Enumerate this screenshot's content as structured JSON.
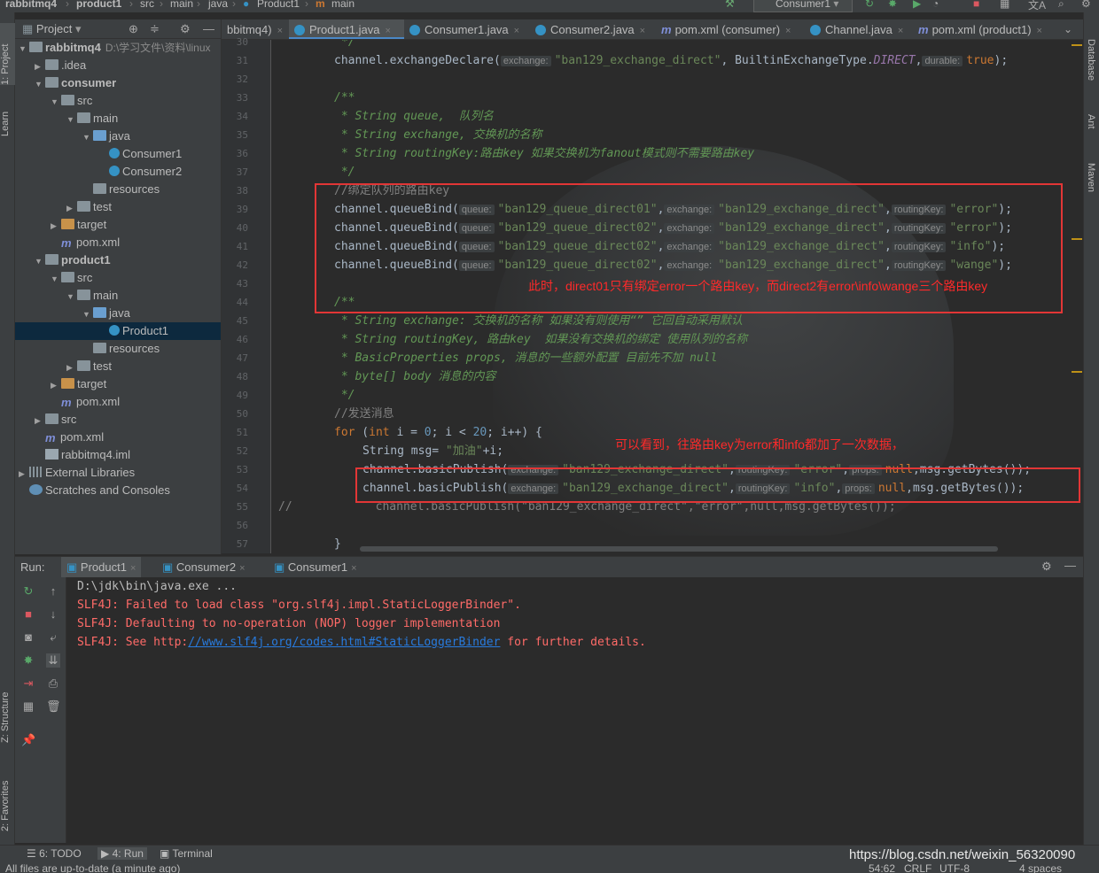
{
  "navbar": {
    "crumbs": [
      "rabbitmq4",
      "product1",
      "src",
      "main",
      "java",
      "Product1",
      "main"
    ],
    "run_config": "Consumer1"
  },
  "left_strip": {
    "project": "1: Project",
    "learn": "Learn",
    "structure": "Z: Structure",
    "favorites": "2: Favorites"
  },
  "right_strip": {
    "database": "Database",
    "ant": "Ant",
    "maven": "Maven"
  },
  "project_panel": {
    "title": "Project",
    "tree": [
      {
        "label": "rabbitmq4",
        "path": "D:\\学习文件\\资料\\linux",
        "bold": true,
        "indent": 0,
        "arrow": "▼",
        "icon": "folder"
      },
      {
        "label": ".idea",
        "indent": 1,
        "arrow": "▶",
        "icon": "folder"
      },
      {
        "label": "consumer",
        "bold": true,
        "indent": 1,
        "arrow": "▼",
        "icon": "folder"
      },
      {
        "label": "src",
        "indent": 2,
        "arrow": "▼",
        "icon": "folder"
      },
      {
        "label": "main",
        "indent": 3,
        "arrow": "▼",
        "icon": "folder"
      },
      {
        "label": "java",
        "indent": 4,
        "arrow": "▼",
        "icon": "folder-b"
      },
      {
        "label": "Consumer1",
        "indent": 5,
        "arrow": "",
        "icon": "class"
      },
      {
        "label": "Consumer2",
        "indent": 5,
        "arrow": "",
        "icon": "class"
      },
      {
        "label": "resources",
        "indent": 4,
        "arrow": "",
        "icon": "folder"
      },
      {
        "label": "test",
        "indent": 3,
        "arrow": "▶",
        "icon": "folder"
      },
      {
        "label": "target",
        "indent": 2,
        "arrow": "▶",
        "icon": "folder-o"
      },
      {
        "label": "pom.xml",
        "indent": 2,
        "arrow": "",
        "icon": "maven"
      },
      {
        "label": "product1",
        "bold": true,
        "indent": 1,
        "arrow": "▼",
        "icon": "folder"
      },
      {
        "label": "src",
        "indent": 2,
        "arrow": "▼",
        "icon": "folder"
      },
      {
        "label": "main",
        "indent": 3,
        "arrow": "▼",
        "icon": "folder"
      },
      {
        "label": "java",
        "indent": 4,
        "arrow": "▼",
        "icon": "folder-b"
      },
      {
        "label": "Product1",
        "indent": 5,
        "arrow": "",
        "icon": "class",
        "selected": true
      },
      {
        "label": "resources",
        "indent": 4,
        "arrow": "",
        "icon": "folder"
      },
      {
        "label": "test",
        "indent": 3,
        "arrow": "▶",
        "icon": "folder"
      },
      {
        "label": "target",
        "indent": 2,
        "arrow": "▶",
        "icon": "folder-o"
      },
      {
        "label": "pom.xml",
        "indent": 2,
        "arrow": "",
        "icon": "maven"
      },
      {
        "label": "src",
        "indent": 1,
        "arrow": "▶",
        "icon": "folder"
      },
      {
        "label": "pom.xml",
        "indent": 1,
        "arrow": "",
        "icon": "maven"
      },
      {
        "label": "rabbitmq4.iml",
        "indent": 1,
        "arrow": "",
        "icon": "file"
      },
      {
        "label": "External Libraries",
        "indent": 0,
        "arrow": "▶",
        "icon": "lib"
      },
      {
        "label": "Scratches and Consoles",
        "indent": 0,
        "arrow": "",
        "icon": "scratch"
      }
    ]
  },
  "tabs": [
    {
      "label": "bbitmq4)",
      "icon": "none",
      "active": false
    },
    {
      "label": "Product1.java",
      "icon": "class",
      "active": true
    },
    {
      "label": "Consumer1.java",
      "icon": "class",
      "active": false
    },
    {
      "label": "Consumer2.java",
      "icon": "class",
      "active": false
    },
    {
      "label": "pom.xml (consumer)",
      "icon": "maven",
      "active": false
    },
    {
      "label": "Channel.java",
      "icon": "class",
      "active": false
    },
    {
      "label": "pom.xml (product1)",
      "icon": "maven",
      "active": false
    }
  ],
  "editor": {
    "line_numbers": [
      "30",
      "31",
      "32",
      "33",
      "34",
      "35",
      "36",
      "37",
      "38",
      "39",
      "40",
      "41",
      "42",
      "43",
      "44",
      "45",
      "46",
      "47",
      "48",
      "49",
      "50",
      "51",
      "52",
      "53",
      "54",
      "55",
      "56",
      "57"
    ],
    "hints": {
      "queue": "queue:",
      "exchange": "exchange:",
      "routingKey": "routingKey:",
      "props": "props:",
      "durable": "durable:"
    },
    "code": {
      "l30": "*/",
      "l31_a": "channel.exchangeDeclare(",
      "l31_b": "\"ban129_exchange_direct\"",
      "l31_c": ", BuiltinExchangeType.",
      "l31_d": "DIRECT",
      "l31_e": ",",
      "l31_f": "true",
      "l31_g": ");",
      "l33": "/**",
      "l34": " * String queue,  队列名",
      "l35": " * String exchange, 交换机的名称",
      "l36": " * String routingKey:路由key 如果交换机为fanout模式则不需要路由key",
      "l37": " */",
      "l38": "//绑定队列的路由key",
      "bind_prefix": "channel.queueBind(",
      "q1": "\"ban129_queue_direct01\"",
      "q2": "\"ban129_queue_direct02\"",
      "ex": "\"ban129_exchange_direct\"",
      "rk1": "\"error\"",
      "rk2": "\"error\"",
      "rk3": "\"info\"",
      "rk4": "\"wange\"",
      "bind_suffix": ");",
      "comma": ",",
      "l44": "/**",
      "l45": " * String exchange: 交换机的名称 如果没有则使用“” 它回自动采用默认",
      "l46": " * String routingKey, 路由key  如果没有交换机的绑定 使用队列的名称",
      "l47": " * BasicProperties props, 消息的一些额外配置 目前先不加 null",
      "l48": " * byte[] body 消息的内容",
      "l49": " */",
      "l50": "//发送消息",
      "l51_kw1": "for",
      "l51_a": " (",
      "l51_kw2": "int",
      "l51_b": " i = ",
      "l51_n1": "0",
      "l51_c": "; i < ",
      "l51_n2": "20",
      "l51_d": "; i++) {",
      "l52_a": "String msg= ",
      "l52_s": "\"加油\"",
      "l52_b": "+i;",
      "pub_prefix": "channel.basicPublish(",
      "pub_ex": "\"ban129_exchange_direct\"",
      "pub_rk1": "\"error\"",
      "pub_rk2": "\"info\"",
      "pub_null": "null",
      "pub_suffix": ",msg.getBytes());",
      "l55_cm": "//",
      "l55_code": "channel.basicPublish(\"ban129_exchange_direct\",\"error\",null,msg.getBytes());",
      "l57": "}"
    },
    "annotation_1": "此时，direct01只有绑定error一个路由key，而direct2有error\\info\\wange三个路由key",
    "annotation_2": "可以看到，往路由key为error和info都加了一次数据，"
  },
  "run_panel": {
    "label": "Run:",
    "tabs": [
      {
        "label": "Product1",
        "active": true
      },
      {
        "label": "Consumer2",
        "active": false
      },
      {
        "label": "Consumer1",
        "active": false
      }
    ],
    "console": {
      "cmd": "D:\\jdk\\bin\\java.exe ...",
      "err1": "SLF4J: Failed to load class \"org.slf4j.impl.StaticLoggerBinder\".",
      "err2": "SLF4J: Defaulting to no-operation (NOP) logger implementation",
      "err3_a": "SLF4J: See http:",
      "err3_link": "//www.slf4j.org/codes.html#StaticLoggerBinder",
      "err3_b": " for further details."
    }
  },
  "bottom_bar": {
    "todo": "6: TODO",
    "run": "4: Run",
    "terminal": "Terminal"
  },
  "status_bar": {
    "message": "All files are up-to-date (a minute ago)",
    "position": "54:62",
    "line_sep": "CRLF",
    "encoding": "UTF-8",
    "indent": "4 spaces"
  },
  "watermark": "https://blog.csdn.net/weixin_56320090",
  "colors": {
    "background": "#2b2b2b",
    "panel": "#3c3f41",
    "keyword": "#cc7832",
    "string": "#6a8759",
    "comment": "#808080",
    "doc": "#629755",
    "annotation_red": "#e23636"
  }
}
